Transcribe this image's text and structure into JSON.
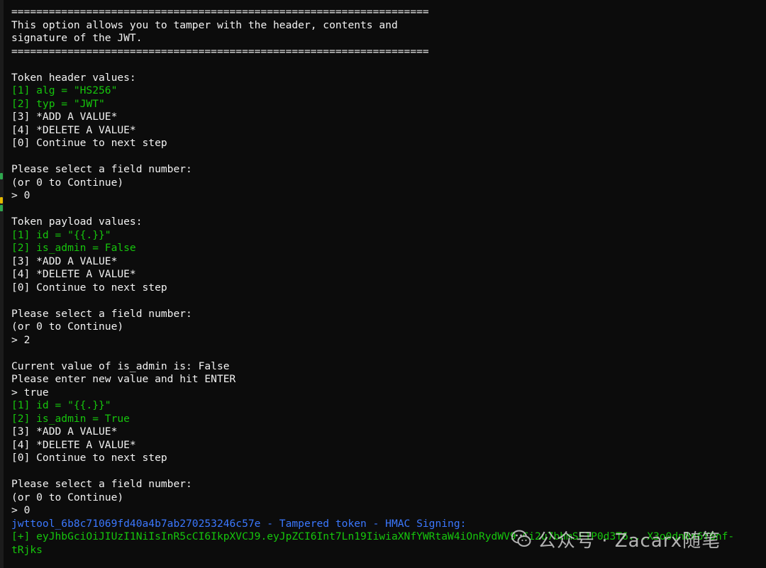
{
  "colors": {
    "background": "#0c0c0c",
    "default_text": "#f2f2f2",
    "green_text": "#16c60c",
    "blue_text": "#3b78ff"
  },
  "terminal": {
    "lines": [
      {
        "text": "===================================================================",
        "color": "white"
      },
      {
        "text": "This option allows you to tamper with the header, contents and",
        "color": "white"
      },
      {
        "text": "signature of the JWT.",
        "color": "white"
      },
      {
        "text": "===================================================================",
        "color": "white"
      },
      {
        "text": "",
        "color": "white"
      },
      {
        "text": "Token header values:",
        "color": "white"
      },
      {
        "text": "[1] alg = \"HS256\"",
        "color": "green"
      },
      {
        "text": "[2] typ = \"JWT\"",
        "color": "green"
      },
      {
        "text": "[3] *ADD A VALUE*",
        "color": "white"
      },
      {
        "text": "[4] *DELETE A VALUE*",
        "color": "white"
      },
      {
        "text": "[0] Continue to next step",
        "color": "white"
      },
      {
        "text": "",
        "color": "white"
      },
      {
        "text": "Please select a field number:",
        "color": "white"
      },
      {
        "text": "(or 0 to Continue)",
        "color": "white"
      },
      {
        "text": "> 0",
        "color": "white"
      },
      {
        "text": "",
        "color": "white"
      },
      {
        "text": "Token payload values:",
        "color": "white"
      },
      {
        "text": "[1] id = \"{{.}}\"",
        "color": "green"
      },
      {
        "text": "[2] is_admin = False",
        "color": "green"
      },
      {
        "text": "[3] *ADD A VALUE*",
        "color": "white"
      },
      {
        "text": "[4] *DELETE A VALUE*",
        "color": "white"
      },
      {
        "text": "[0] Continue to next step",
        "color": "white"
      },
      {
        "text": "",
        "color": "white"
      },
      {
        "text": "Please select a field number:",
        "color": "white"
      },
      {
        "text": "(or 0 to Continue)",
        "color": "white"
      },
      {
        "text": "> 2",
        "color": "white"
      },
      {
        "text": "",
        "color": "white"
      },
      {
        "text": "Current value of is_admin is: False",
        "color": "white"
      },
      {
        "text": "Please enter new value and hit ENTER",
        "color": "white"
      },
      {
        "text": "> true",
        "color": "white"
      },
      {
        "text": "[1] id = \"{{.}}\"",
        "color": "green"
      },
      {
        "text": "[2] is_admin = True",
        "color": "green"
      },
      {
        "text": "[3] *ADD A VALUE*",
        "color": "white"
      },
      {
        "text": "[4] *DELETE A VALUE*",
        "color": "white"
      },
      {
        "text": "[0] Continue to next step",
        "color": "white"
      },
      {
        "text": "",
        "color": "white"
      },
      {
        "text": "Please select a field number:",
        "color": "white"
      },
      {
        "text": "(or 0 to Continue)",
        "color": "white"
      },
      {
        "text": "> 0",
        "color": "white"
      },
      {
        "text": "jwttool_6b8c71069fd40a4b7ab270253246c57e - Tampered token - HMAC Signing:",
        "color": "blue"
      },
      {
        "text": "[+] eyJhbGciOiJIUzI1NiIsInR5cCI6IkpXVCJ9.eyJpZCI6Int7Ln19IiwiaXNfYWRtaW4iOnRydWV9.Ci2u7bhmSF1P0d3T6...X3o0dn8n6Y6nf-",
        "color": "green"
      },
      {
        "text": "tRjks",
        "color": "green"
      }
    ]
  },
  "watermark": {
    "icon": "wechat-icon",
    "text": "公众号 · Zacarx随笔"
  }
}
